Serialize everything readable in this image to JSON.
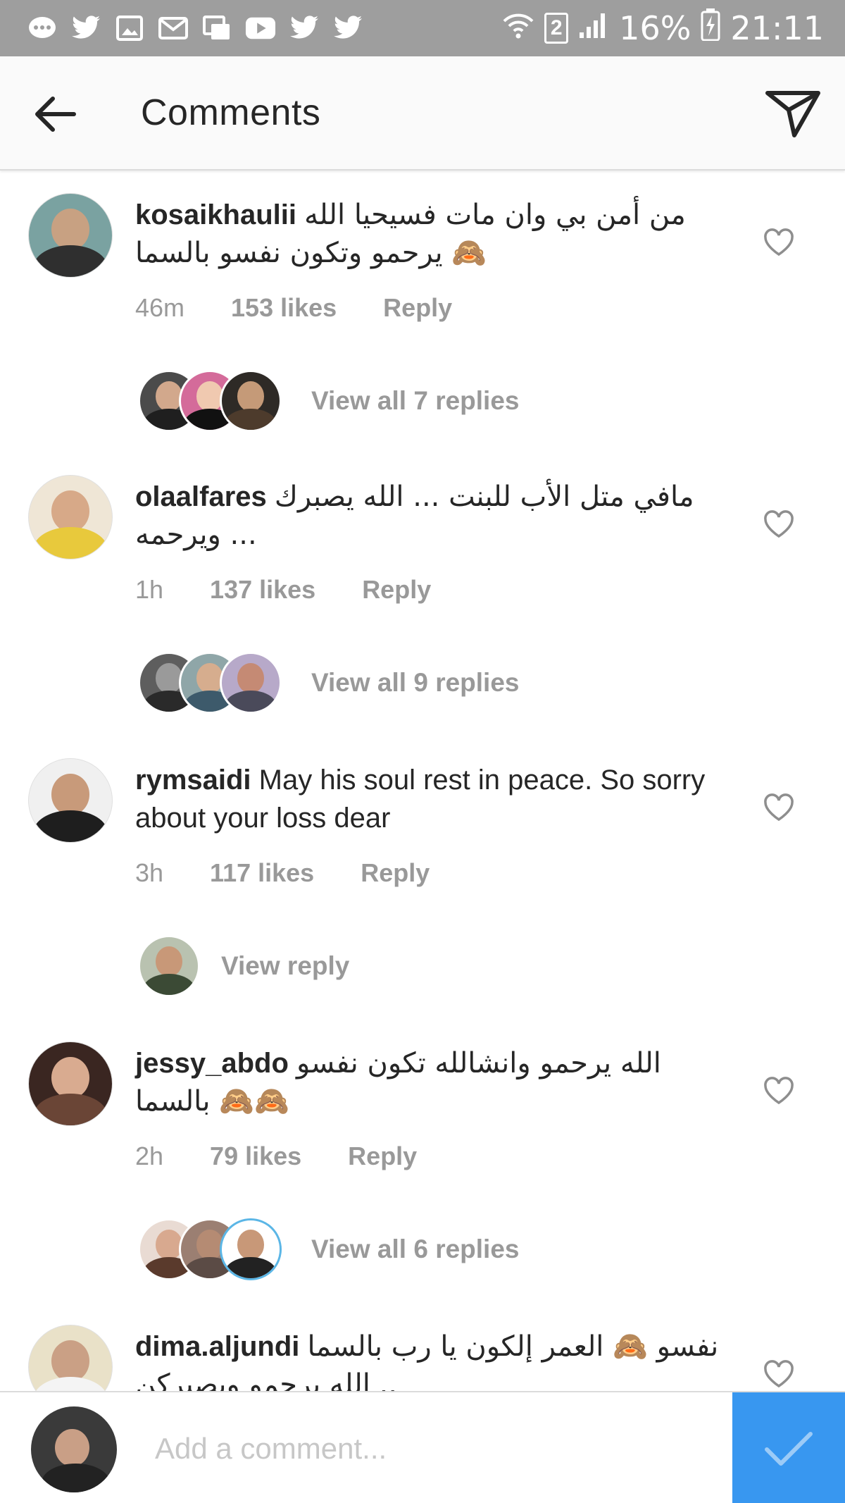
{
  "status_bar": {
    "sim_slot": "2",
    "battery": "16%",
    "time": "21:11"
  },
  "header": {
    "title": "Comments"
  },
  "comments": [
    {
      "username": "kosaikhaulii",
      "text": "من أمن بي وان مات فسيحيا الله يرحمو وتكون نفسو بالسما 🙈",
      "time": "46m",
      "likes": "153 likes",
      "reply": "Reply",
      "view_replies": "View all 7 replies",
      "avatar_color": "#6b8a8c"
    },
    {
      "username": "olaalfares",
      "text": "مافي متل الأب  للبنت ... الله يصبرك ويرحمه ...",
      "time": "1h",
      "likes": "137 likes",
      "reply": "Reply",
      "view_replies": "View all 9 replies",
      "avatar_color": "#e6c34a"
    },
    {
      "username": "rymsaidi",
      "text": "May his soul rest in peace. So sorry about your loss dear",
      "time": "3h",
      "likes": "117 likes",
      "reply": "Reply",
      "view_replies": "View reply",
      "avatar_color": "#e8e8e8"
    },
    {
      "username": "jessy_abdo",
      "text": "الله يرحمو وانشالله تكون نفسو بالسما 🙈🙈",
      "time": "2h",
      "likes": "79 likes",
      "reply": "Reply",
      "view_replies": "View all 6 replies",
      "avatar_color": "#5a3a32"
    },
    {
      "username": "dima.aljundi",
      "text": "نفسو 🙈 العمر إلكون يا رب بالسما .. الله يرحمو ويصبركن",
      "time": "",
      "likes": "",
      "reply": "",
      "view_replies": "",
      "avatar_color": "#e9e1c8"
    }
  ],
  "composer": {
    "placeholder": "Add a comment..."
  },
  "icons": {
    "back": "arrow-left-icon",
    "share": "paper-plane-icon",
    "like": "heart-outline-icon",
    "post": "checkmark-icon"
  },
  "colors": {
    "status_bar": "#9e9e9e",
    "secondary_text": "#999999",
    "post_button": "#3897f0"
  }
}
